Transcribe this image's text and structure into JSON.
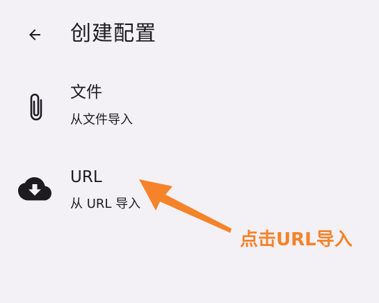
{
  "header": {
    "title": "创建配置",
    "back_icon": "arrow-back-icon"
  },
  "options": [
    {
      "icon": "paperclip-icon",
      "title": "文件",
      "subtitle": "从文件导入"
    },
    {
      "icon": "cloud-download-icon",
      "title": "URL",
      "subtitle": "从 URL 导入"
    }
  ],
  "annotation": {
    "text": "点击URL导入",
    "color": "#f5832a"
  },
  "colors": {
    "background": "#f3f1f6",
    "text": "#1d1b20"
  }
}
